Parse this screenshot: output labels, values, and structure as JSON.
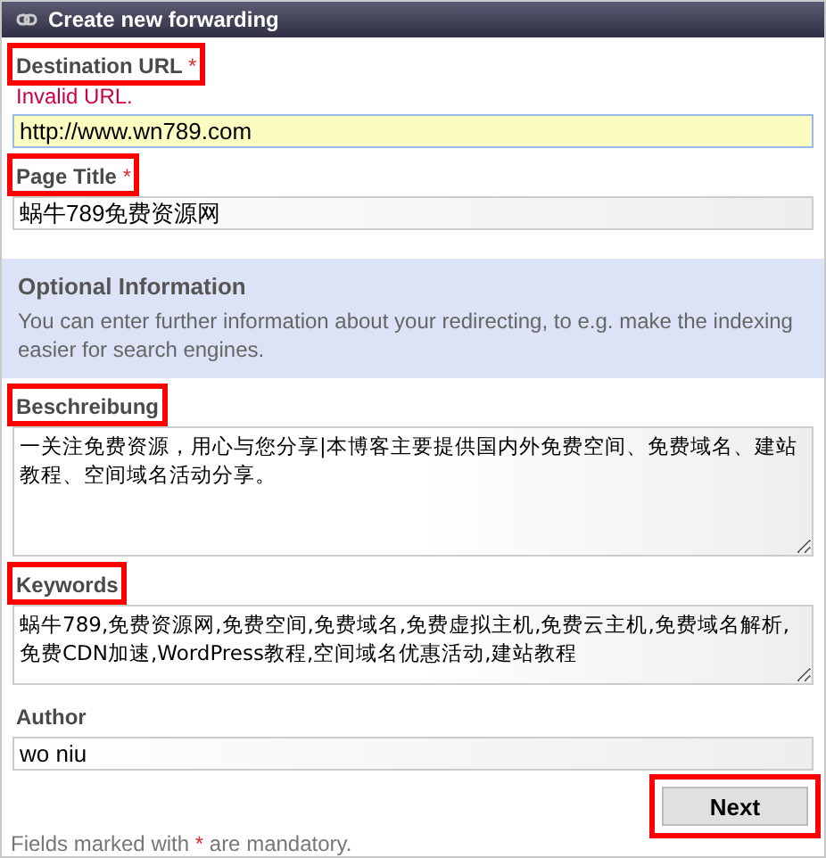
{
  "header": {
    "title": "Create new forwarding"
  },
  "required_fields": [
    {
      "kind": "input",
      "label": "Destination URL",
      "marker": "*",
      "error": "Invalid URL.",
      "value": "http://www.wn789.com",
      "invalid": true,
      "highlighted": true
    },
    {
      "kind": "input",
      "label": "Page Title",
      "marker": "*",
      "value": "蜗牛789免费资源网",
      "invalid": false,
      "highlighted": true
    }
  ],
  "optional_info": {
    "title": "Optional Information",
    "text": "You can enter further information about your redirecting, to e.g. make the indexing easier for search engines."
  },
  "optional_fields": [
    {
      "kind": "tall_textarea",
      "label": "Beschreibung",
      "value": "一关注免费资源，用心与您分享|本博客主要提供国内外免费空间、免费域名、建站教程、空间域名活动分享。",
      "highlighted": true
    },
    {
      "kind": "textarea",
      "label": "Keywords",
      "value": "蜗牛789,免费资源网,免费空间,免费域名,免费虚拟主机,免费云主机,免费域名解析,免费CDN加速,WordPress教程,空间域名优惠活动,建站教程",
      "highlighted": true
    },
    {
      "kind": "input",
      "label": "Author",
      "value": "wo niu",
      "invalid": false,
      "highlighted": false
    }
  ],
  "next_button": {
    "label": "Next",
    "highlighted": true
  },
  "note": {
    "before": "Fields marked with",
    "mark": "*",
    "after": "are mandatory."
  }
}
